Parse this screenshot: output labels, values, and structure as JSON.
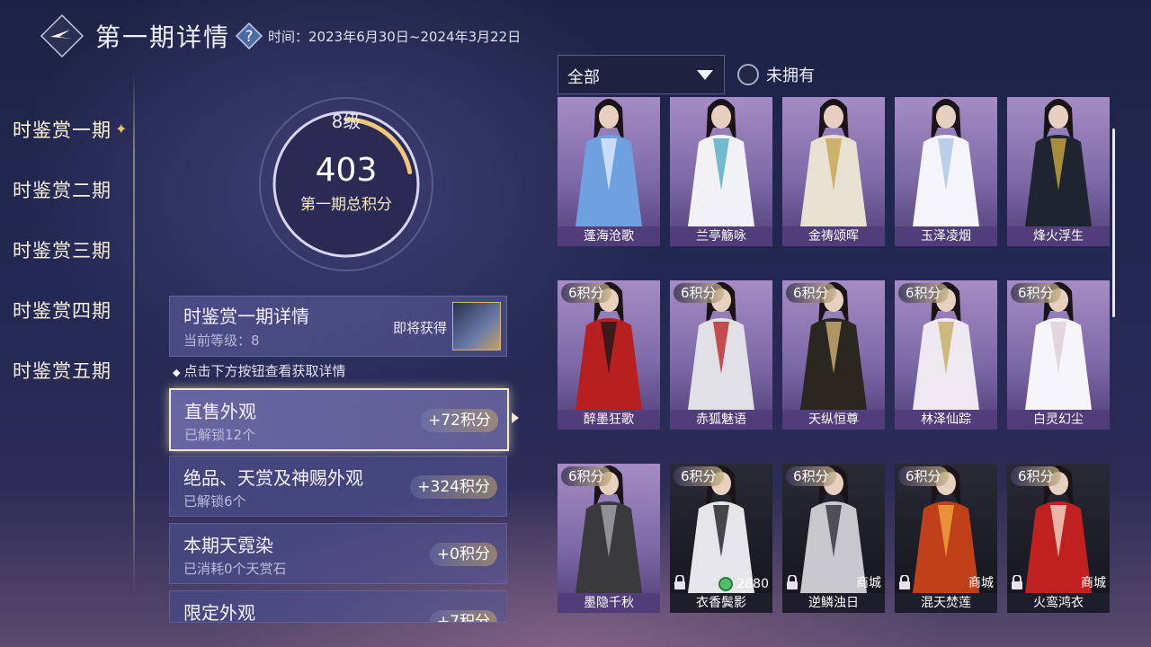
{
  "header": {
    "title": "第一期详情",
    "period": "时间：2023年6月30日~2024年3月22日"
  },
  "tabs": [
    {
      "label": "时鉴赏一期",
      "active": true
    },
    {
      "label": "时鉴赏二期"
    },
    {
      "label": "时鉴赏三期"
    },
    {
      "label": "时鉴赏四期"
    },
    {
      "label": "时鉴赏五期"
    }
  ],
  "score": {
    "level": "8级",
    "points": "403",
    "label": "第一期总积分",
    "progress": 0.22
  },
  "detail": {
    "title": "时鉴赏一期详情",
    "current_level": "当前等级：8",
    "coming_soon": "即将获得"
  },
  "hint": "点击下方按钮查看获取详情",
  "categories": [
    {
      "title": "直售外观",
      "sub": "已解锁12个",
      "points": "+72积分"
    },
    {
      "title": "绝品、天赏及神赐外观",
      "sub": "已解锁6个",
      "points": "+324积分"
    },
    {
      "title": "本期天霓染",
      "sub": "已消耗0个天赏石",
      "points": "+0积分"
    },
    {
      "title": "限定外观",
      "sub": "",
      "points": "+7积分"
    }
  ],
  "filter": {
    "value": "全部",
    "owned_label": "未拥有"
  },
  "items": [
    {
      "name": "蓬海沧歌",
      "badge": "",
      "tag": ""
    },
    {
      "name": "兰亭觞咏",
      "badge": "",
      "tag": ""
    },
    {
      "name": "金祷颂晖",
      "badge": "",
      "tag": ""
    },
    {
      "name": "玉泽凌烟",
      "badge": "",
      "tag": ""
    },
    {
      "name": "烽火浮生",
      "badge": "",
      "tag": ""
    },
    {
      "name": "醉墨狂歌",
      "badge": "6积分",
      "tag": ""
    },
    {
      "name": "赤狐魅语",
      "badge": "6积分",
      "tag": ""
    },
    {
      "name": "天纵恒尊",
      "badge": "6积分",
      "tag": ""
    },
    {
      "name": "林泽仙踪",
      "badge": "6积分",
      "tag": ""
    },
    {
      "name": "白灵幻尘",
      "badge": "6积分",
      "tag": ""
    },
    {
      "name": "墨隐千秋",
      "badge": "6积分",
      "tag": ""
    },
    {
      "name": "衣香鬓影",
      "badge": "6积分",
      "tag": "2880"
    },
    {
      "name": "逆鳞浊日",
      "badge": "6积分",
      "tag": "商城"
    },
    {
      "name": "混天焚莲",
      "badge": "6积分",
      "tag": "商城"
    },
    {
      "name": "火鸾鸿衣",
      "badge": "6积分",
      "tag": "商城"
    }
  ],
  "colors": {
    "accent_gold": "#e6c878",
    "card_bg": "#4a4a8a",
    "coin_green": "#4fc06a"
  }
}
